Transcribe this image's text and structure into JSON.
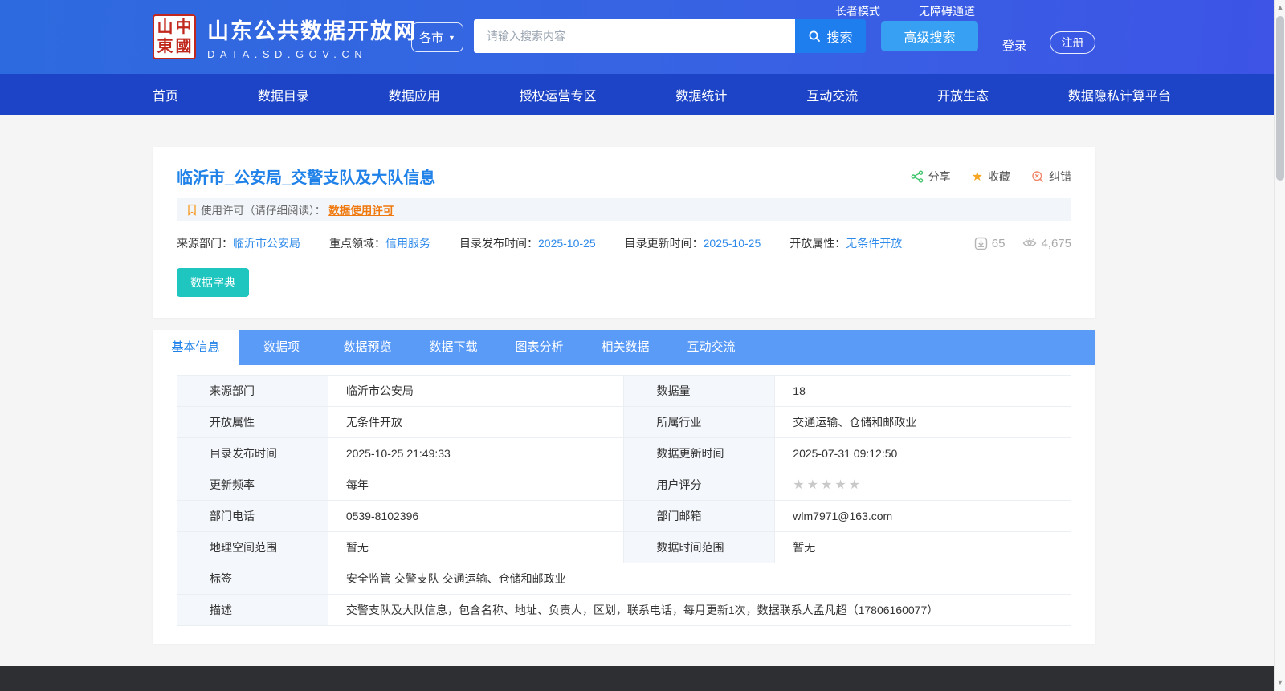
{
  "header": {
    "seal_chars": [
      "山",
      "中",
      "東",
      "國"
    ],
    "site_name": "山东公共数据开放网",
    "site_domain": "DATA.SD.GOV.CN",
    "city_dropdown": "各市",
    "search_placeholder": "请输入搜索内容",
    "search_button": "搜索",
    "advanced_search_button": "高级搜索",
    "elder_mode_link": "长者模式",
    "accessibility_link": "无障碍通道",
    "login_link": "登录",
    "register_button": "注册"
  },
  "nav": {
    "items": [
      {
        "label": "首页"
      },
      {
        "label": "数据目录"
      },
      {
        "label": "数据应用"
      },
      {
        "label": "授权运营专区"
      },
      {
        "label": "数据统计"
      },
      {
        "label": "互动交流"
      },
      {
        "label": "开放生态"
      },
      {
        "label": "数据隐私计算平台"
      }
    ]
  },
  "dataset": {
    "title": "临沂市_公安局_交警支队及大队信息",
    "share_label": "分享",
    "favorite_label": "收藏",
    "correct_label": "纠错",
    "license_prefix": "使用许可（请仔细阅读）：",
    "license_link": "数据使用许可",
    "meta": [
      {
        "label": "来源部门：",
        "value": "临沂市公安局"
      },
      {
        "label": "重点领域：",
        "value": "信用服务"
      },
      {
        "label": "目录发布时间：",
        "value": "2025-10-25"
      },
      {
        "label": "目录更新时间：",
        "value": "2025-10-25"
      },
      {
        "label": "开放属性：",
        "value": "无条件开放"
      }
    ],
    "download_count": "65",
    "view_count": "4,675",
    "dictionary_button": "数据字典"
  },
  "tabs": {
    "items": [
      {
        "label": "基本信息",
        "active": true
      },
      {
        "label": "数据项",
        "active": false
      },
      {
        "label": "数据预览",
        "active": false
      },
      {
        "label": "数据下载",
        "active": false
      },
      {
        "label": "图表分析",
        "active": false
      },
      {
        "label": "相关数据",
        "active": false
      },
      {
        "label": "互动交流",
        "active": false
      }
    ]
  },
  "info_table": {
    "rows": [
      {
        "l1": "来源部门",
        "v1": "临沂市公安局",
        "l2": "数据量",
        "v2": "18"
      },
      {
        "l1": "开放属性",
        "v1": "无条件开放",
        "l2": "所属行业",
        "v2": "交通运输、仓储和邮政业"
      },
      {
        "l1": "目录发布时间",
        "v1": "2025-10-25 21:49:33",
        "l2": "数据更新时间",
        "v2": "2025-07-31 09:12:50"
      },
      {
        "l1": "更新频率",
        "v1": "每年",
        "l2": "用户评分",
        "v2": "★★★★★"
      },
      {
        "l1": "部门电话",
        "v1": "0539-8102396",
        "l2": "部门邮箱",
        "v2": "wlm7971@163.com"
      },
      {
        "l1": "地理空间范围",
        "v1": "暂无",
        "l2": "数据时间范围",
        "v2": "暂无"
      }
    ],
    "full_rows": [
      {
        "label": "标签",
        "value": "安全监管 交警支队 交通运输、仓储和邮政业"
      },
      {
        "label": "描述",
        "value": "交警支队及大队信息，包含名称、地址、负责人，区划，联系电话，每月更新1次，数据联系人孟凡超（17806160077）"
      }
    ]
  },
  "colors": {
    "header_blue": "#2E6ADF",
    "nav_blue": "#1D44C6",
    "tab_blue": "#5B9BF8",
    "link_blue": "#2082E8",
    "teal_button": "#1FC6BF",
    "star_orange": "#F5A623",
    "license_orange": "#F0790F",
    "share_green": "#3FC46B",
    "seal_red": "#C0281E"
  }
}
